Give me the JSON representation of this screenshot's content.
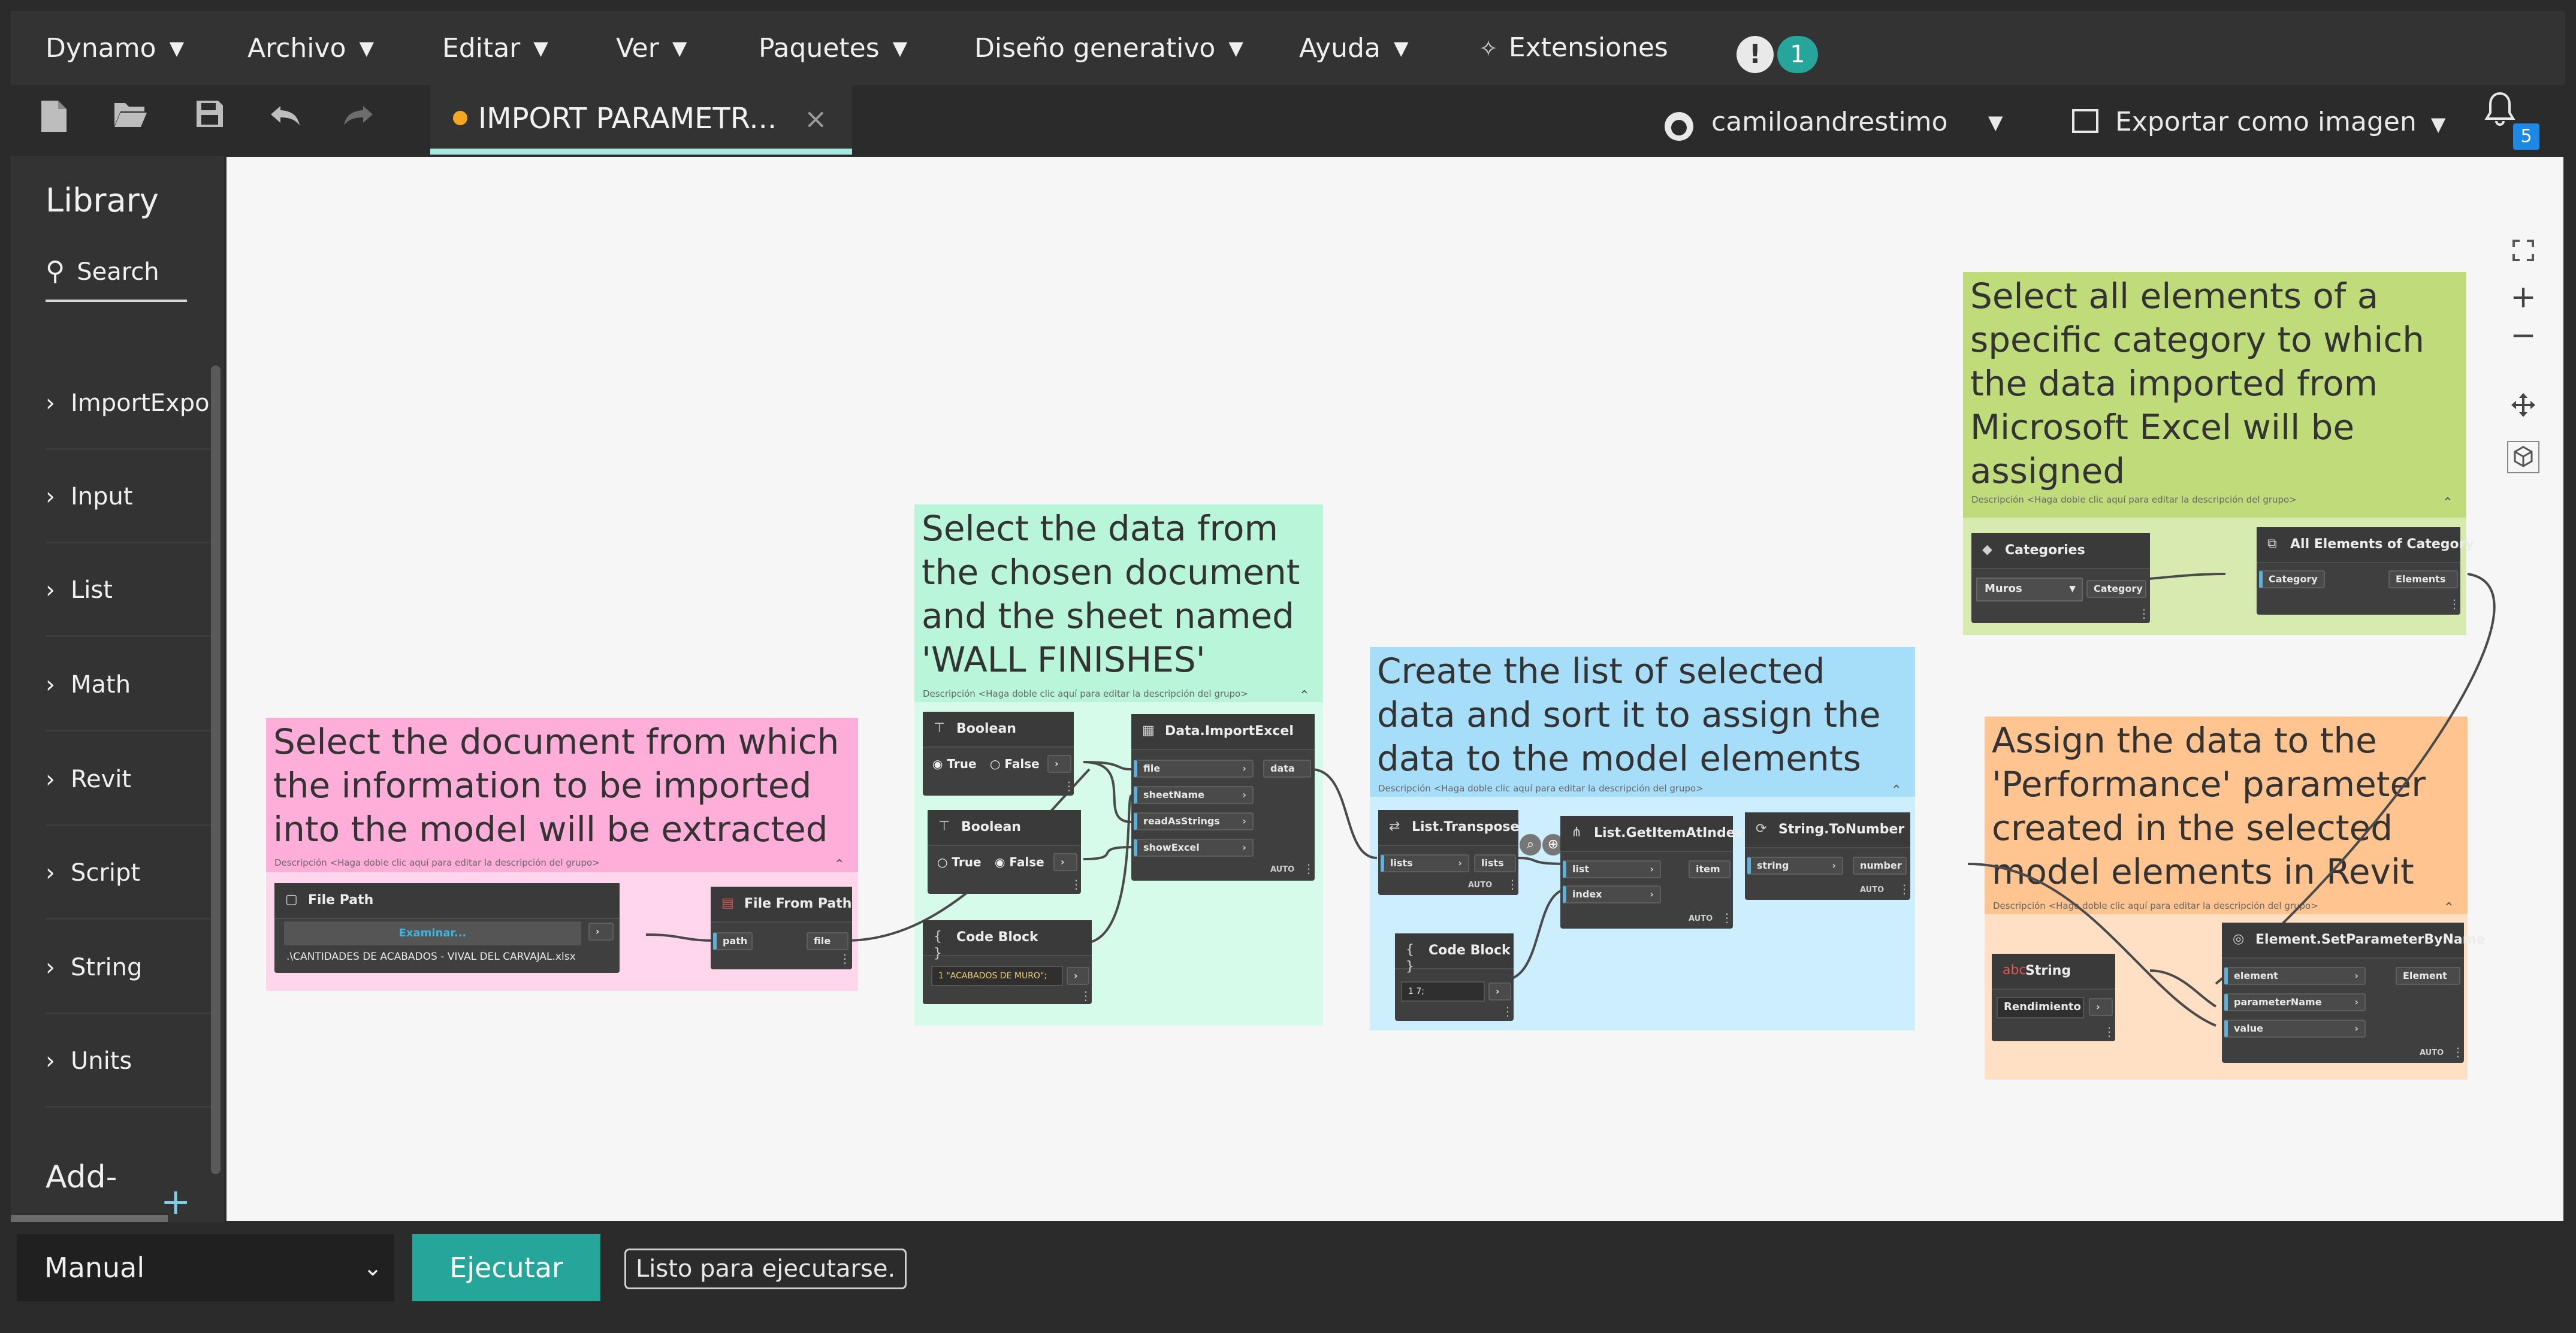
{
  "menu": {
    "items": [
      "Dynamo",
      "Archivo",
      "Editar",
      "Ver",
      "Paquetes",
      "Diseño generativo",
      "Ayuda"
    ],
    "extensions": "Extensiones",
    "notification_count": "1",
    "notice_icon": "!"
  },
  "toolbar": {
    "tab_label": "IMPORT PARAMETR...",
    "tab_close": "×",
    "user": "camiloandrestimo",
    "export_label": "Exportar como imagen",
    "bell_badge": "5"
  },
  "library": {
    "title": "Library",
    "search_placeholder": "Search",
    "items": [
      "ImportExport",
      "Input",
      "List",
      "Math",
      "Revit",
      "Script",
      "String",
      "Units"
    ],
    "add_label": "Add-"
  },
  "canvas": {
    "groups": [
      {
        "title": "Select the document from which the information to be imported into the model will be extracted",
        "description": "Descripción <Haga doble clic aquí para editar la descripción del grupo>",
        "color": "#ffaed9"
      },
      {
        "title": "Select the data from the chosen document and the sheet named 'WALL FINISHES'",
        "description": "Descripción <Haga doble clic aquí para editar la descripción del grupo>",
        "color": "#b9f5d9"
      },
      {
        "title": "Create the list of selected data and sort it to assign the data to the model elements",
        "description": "Descripción <Haga doble clic aquí para editar la descripción del grupo>",
        "color": "#a6defa"
      },
      {
        "title": "Select all elements of a specific category to which the data imported from Microsoft Excel will be assigned",
        "description": "Descripción <Haga doble clic aquí para editar la descripción del grupo>",
        "color": "#c0dc7a"
      },
      {
        "title": "Assign the data to the 'Performance' parameter created in the selected model elements in Revit",
        "description": "Descripción <Haga doble clic aquí para editar la descripción del grupo>",
        "color": "#ffc48f"
      }
    ],
    "nodes": {
      "file_path": {
        "title": "File Path",
        "button": "Examinar...",
        "value": ".\\CANTIDADES DE ACABADOS - VIVAL DEL CARVAJAL.xlsx"
      },
      "file_from_path": {
        "title": "File From Path",
        "input": "path",
        "output": "file"
      },
      "boolean1": {
        "title": "Boolean",
        "true_label": "True",
        "false_label": "False",
        "selected": "True"
      },
      "boolean2": {
        "title": "Boolean",
        "true_label": "True",
        "false_label": "False",
        "selected": "False"
      },
      "code_block1": {
        "title": "Code Block",
        "code": "1 \"ACABADOS DE MURO\";"
      },
      "import_excel": {
        "title": "Data.ImportExcel",
        "inputs": [
          "file",
          "sheetName",
          "readAsStrings",
          "showExcel"
        ],
        "output": "data",
        "lacing": "AUTO"
      },
      "transpose": {
        "title": "List.Transpose",
        "input": "lists",
        "output": "lists",
        "lacing": "AUTO"
      },
      "get_item": {
        "title": "List.GetItemAtIndex",
        "inputs": [
          "list",
          "index"
        ],
        "output": "item",
        "lacing": "AUTO"
      },
      "to_number": {
        "title": "String.ToNumber",
        "input": "string",
        "output": "number",
        "lacing": "AUTO"
      },
      "code_block2": {
        "title": "Code Block",
        "code": "1 7;"
      },
      "categories": {
        "title": "Categories",
        "value": "Muros",
        "output": "Category"
      },
      "all_elements": {
        "title": "All Elements of Category",
        "input": "Category",
        "output": "Elements"
      },
      "string_node": {
        "title": "String",
        "value": "Rendimiento"
      },
      "set_param": {
        "title": "Element.SetParameterByName",
        "inputs": [
          "element",
          "parameterName",
          "value"
        ],
        "output": "Element",
        "lacing": "AUTO"
      }
    }
  },
  "bottom": {
    "run_mode": "Manual",
    "run_button": "Ejecutar",
    "status": "Listo para ejecutarse."
  },
  "colors": {
    "accent": "#26a69a",
    "tab_underline": "#a6e9df",
    "tab_dot": "#f5a623"
  }
}
